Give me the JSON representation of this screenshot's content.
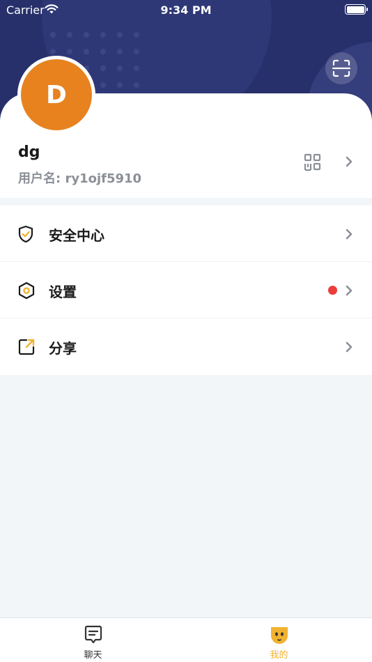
{
  "status_bar": {
    "carrier": "Carrier",
    "time": "9:34 PM"
  },
  "profile": {
    "avatar_letter": "D",
    "nickname": "dg",
    "username": "用户名: ry1ojf5910"
  },
  "menu": {
    "items": [
      {
        "label": "安全中心",
        "icon": "shield-check-icon"
      },
      {
        "label": "设置",
        "icon": "hexagon-settings-icon",
        "has_badge": true
      },
      {
        "label": "分享",
        "icon": "share-icon"
      }
    ]
  },
  "tabs": [
    {
      "label": "聊天",
      "icon": "chat-icon",
      "active": false
    },
    {
      "label": "我的",
      "icon": "face-icon",
      "active": true
    }
  ],
  "colors": {
    "header_bg": "#27306a",
    "avatar_bg": "#e8821f",
    "accent": "#f2b230",
    "badge": "#ec3c3c"
  }
}
